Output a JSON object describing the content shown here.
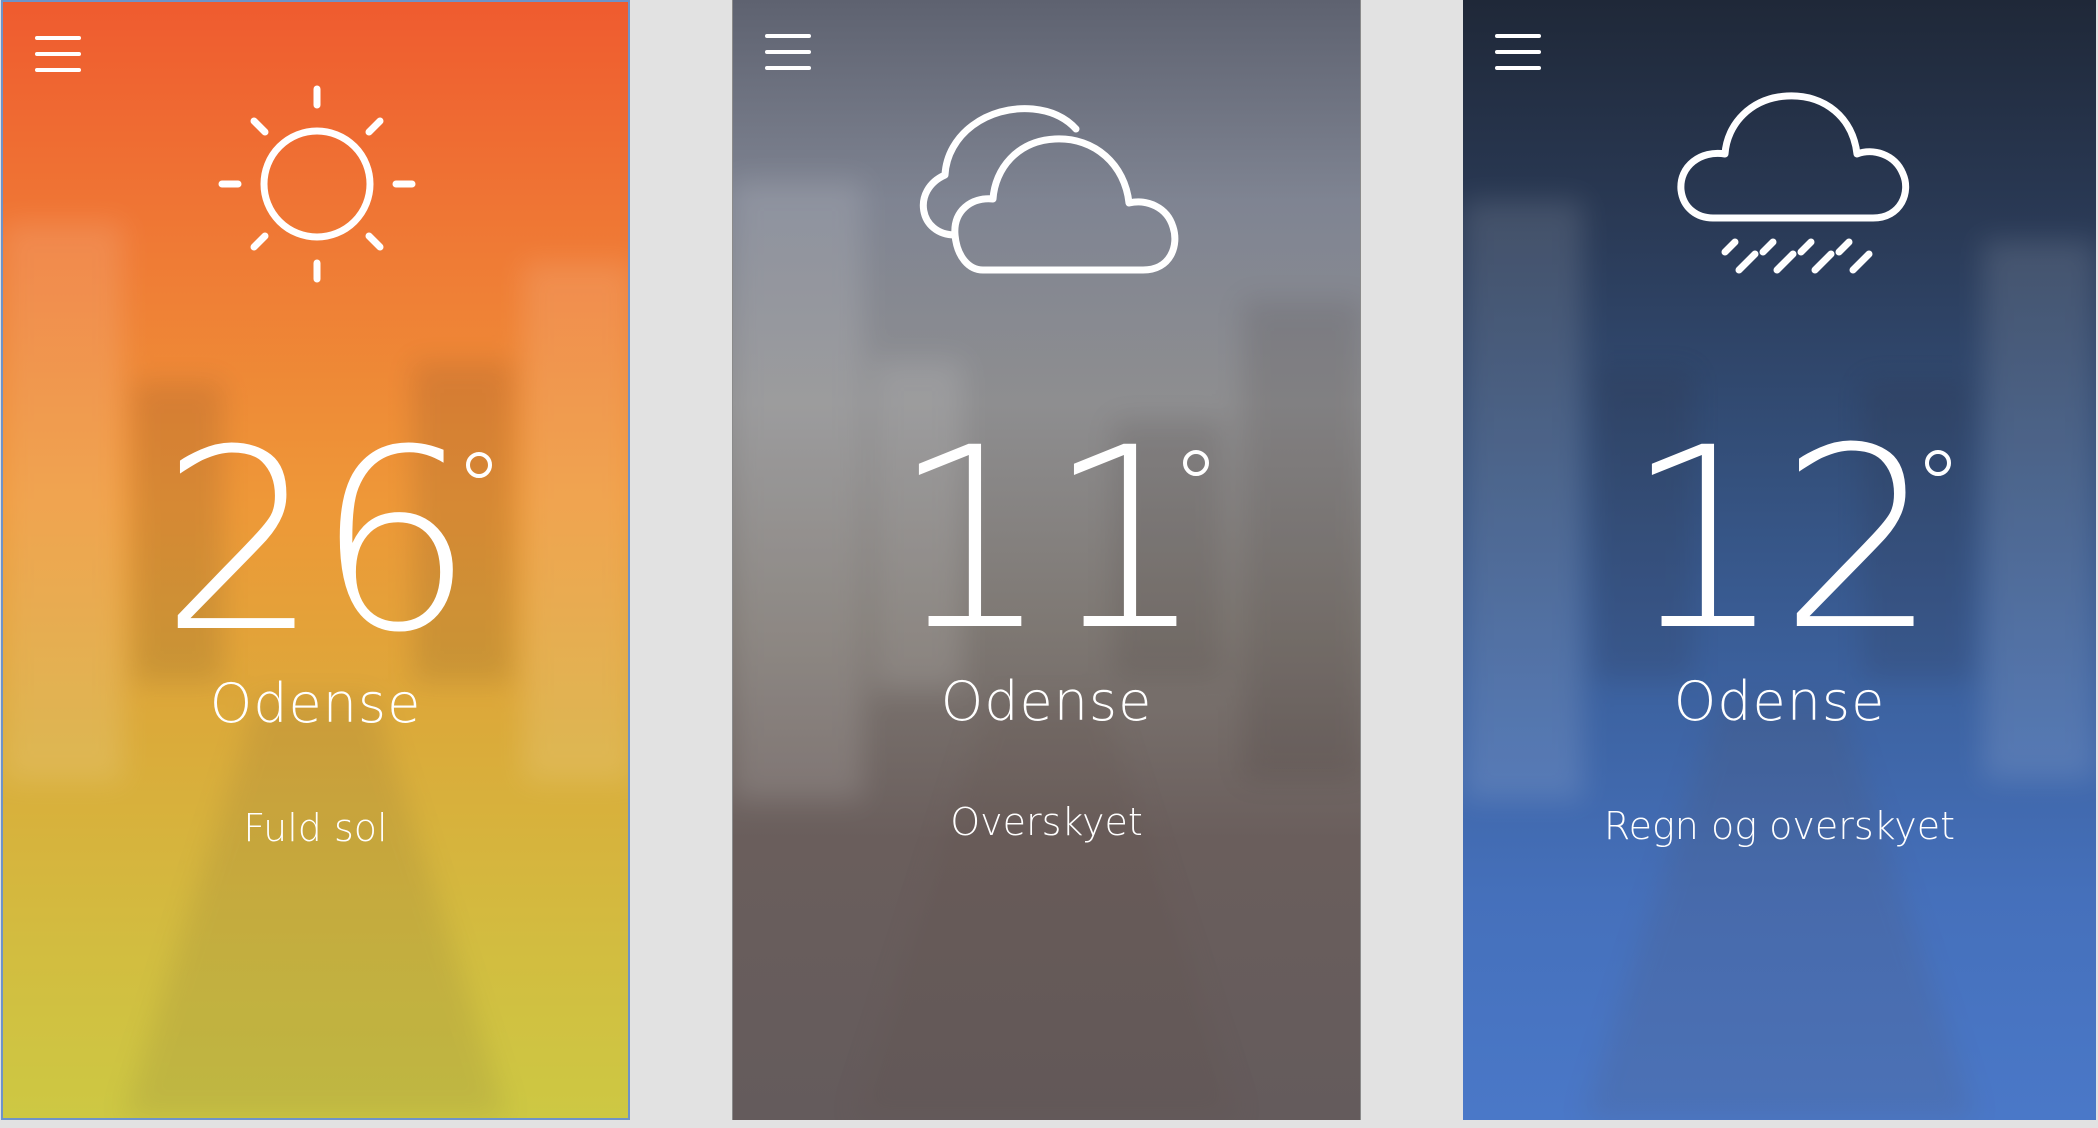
{
  "screens": [
    {
      "id": "sunny",
      "icon": "sun-icon",
      "temperature": "26",
      "city": "Odense",
      "condition": "Fuld sol",
      "gradient_top": "#ef5b2f",
      "gradient_bottom": "#cdc843"
    },
    {
      "id": "cloudy",
      "icon": "cloud-icon",
      "temperature": "11",
      "city": "Odense",
      "condition": "Overskyet",
      "gradient_top": "#5e6270",
      "gradient_bottom": "#645b5c"
    },
    {
      "id": "rainy",
      "icon": "rain-cloud-icon",
      "temperature": "12",
      "city": "Odense",
      "condition": "Regn og overskyet",
      "gradient_top": "#1f2838",
      "gradient_bottom": "#4a78c8"
    }
  ],
  "menu_icon": "hamburger-menu-icon",
  "text_color": "#ffffff",
  "page_background": "#e2e2e2"
}
